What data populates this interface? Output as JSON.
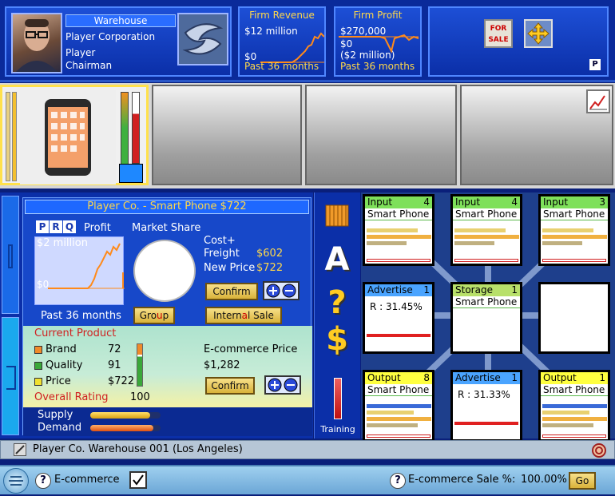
{
  "corp": {
    "warehouse_label": "Warehouse",
    "name": "Player Corporation",
    "player_name": "Player",
    "role": "Chairman"
  },
  "firm_revenue": {
    "title": "Firm Revenue",
    "top": "$12 million",
    "bottom": "$0",
    "footer": "Past 36 months"
  },
  "firm_profit": {
    "title": "Firm Profit",
    "top": "$270,000",
    "mid": "$0",
    "bottom": "($2 million)",
    "footer": "Past 36 months"
  },
  "right_box": {
    "for_sale": "FOR SALE",
    "p": "P"
  },
  "product": {
    "title": "Player Co. - Smart Phone  $722",
    "tabs": [
      "P",
      "R",
      "Q"
    ],
    "profit_label": "Profit",
    "chart_top": "$2 million",
    "chart_bottom": "$0",
    "chart_footer": "Past 36 months",
    "market_share_label": "Market Share",
    "cost_label": "Cost+\nFreight",
    "cost_value": "$602",
    "new_price_label": "New Price",
    "new_price_value": "$722",
    "confirm": "Confirm",
    "group": "Group",
    "internal_sale": "Internal Sale"
  },
  "current_product": {
    "heading": "Current Product",
    "rows": [
      {
        "label": "Brand",
        "value": "72",
        "color": "#f08a2a"
      },
      {
        "label": "Quality",
        "value": "91",
        "color": "#3aa83a"
      },
      {
        "label": "Price",
        "value": "$722",
        "color": "#f0e030"
      }
    ],
    "overall_label": "Overall Rating",
    "overall_value": "100",
    "ecommerce_label": "E-commerce Price",
    "ecommerce_value": "$1,282",
    "confirm": "Confirm"
  },
  "supply_demand": {
    "supply": "Supply",
    "demand": "Demand",
    "supply_level": 0.85,
    "demand_level": 0.9
  },
  "side_icons": {
    "a": "A",
    "q": "?",
    "d": "$",
    "training": "Training"
  },
  "grid": [
    {
      "type": "Input",
      "num": "4",
      "sub": "Smart Phone",
      "kind": "in"
    },
    {
      "type": "Input",
      "num": "4",
      "sub": "Smart Phone",
      "kind": "in"
    },
    {
      "type": "Input",
      "num": "3",
      "sub": "Smart Phone",
      "kind": "in"
    },
    {
      "type": "Advertise",
      "num": "1",
      "sub": "R : 31.45%",
      "kind": "adv"
    },
    {
      "type": "Storage",
      "num": "1",
      "sub": "Smart Phone",
      "kind": "st"
    },
    {
      "type": "",
      "num": "",
      "sub": "",
      "kind": "empty"
    },
    {
      "type": "Output",
      "num": "8",
      "sub": "Smart Phone",
      "kind": "out"
    },
    {
      "type": "Advertise",
      "num": "1",
      "sub": "R : 31.33%",
      "kind": "adv"
    },
    {
      "type": "Output",
      "num": "1",
      "sub": "Smart Phone",
      "kind": "out"
    }
  ],
  "status": {
    "text": "Player Co. Warehouse 001 (Los Angeles)"
  },
  "footer": {
    "left_label": "E-commerce",
    "right_label": "E-commerce Sale %:",
    "right_value": "100.00%",
    "go": "Go"
  }
}
